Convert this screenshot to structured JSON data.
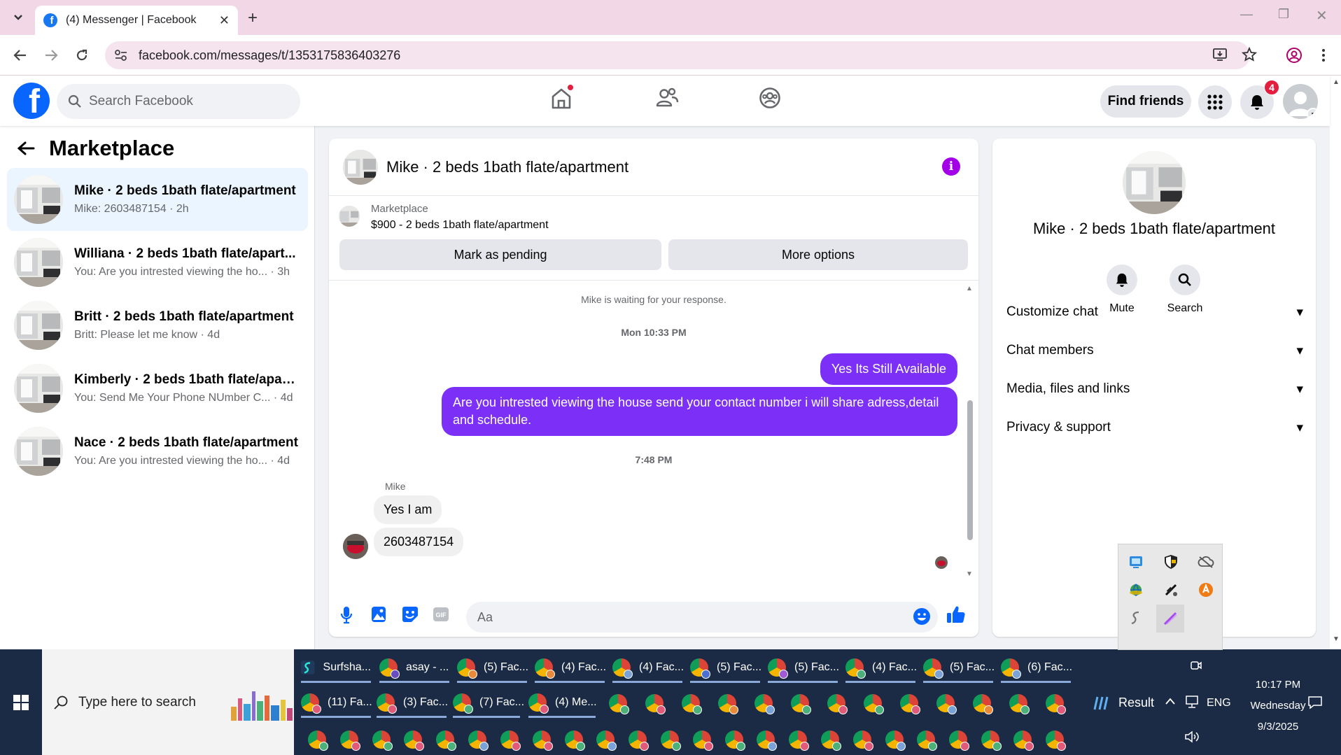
{
  "browser": {
    "tab_title": "(4) Messenger | Facebook",
    "url": "facebook.com/messages/t/1353175836403276"
  },
  "fb_header": {
    "search_placeholder": "Search Facebook",
    "find_friends": "Find friends",
    "notification_count": "4"
  },
  "left_panel": {
    "title": "Marketplace",
    "conversations": [
      {
        "name": "Mike · 2 beds 1bath flate/apartment",
        "preview": "Mike: 2603487154 · 2h",
        "active": true
      },
      {
        "name": "Williana · 2 beds 1bath flate/apart...",
        "preview": "You: Are you intrested viewing the ho... · 3h"
      },
      {
        "name": "Britt · 2 beds 1bath flate/apartment",
        "preview": "Britt: Please let me know · 4d"
      },
      {
        "name": "Kimberly · 2 beds 1bath flate/apart...",
        "preview": "You: Send Me Your Phone NUmber C... · 4d"
      },
      {
        "name": "Nace · 2 beds 1bath flate/apartment",
        "preview": "You: Are you intrested viewing the ho... · 4d"
      }
    ]
  },
  "chat": {
    "title": "Mike · 2 beds 1bath flate/apartment",
    "marketplace_label": "Marketplace",
    "listing": "$900 - 2 beds 1bath flate/apartment",
    "mark_pending": "Mark as pending",
    "more_options": "More options",
    "waiting": "Mike is waiting for your response.",
    "ts1": "Mon 10:33 PM",
    "out1": "Yes Its Still Available",
    "out2": "Are you intrested viewing the house send your contact number i will share adress,detail and schedule.",
    "ts2": "7:48 PM",
    "sender": "Mike",
    "in1": "Yes I am",
    "in2": "2603487154",
    "composer_placeholder": "Aa"
  },
  "right_panel": {
    "name": "Mike · 2 beds 1bath flate/apartment",
    "mute": "Mute",
    "search": "Search",
    "sections": [
      "Customize chat",
      "Chat members",
      "Media, files and links",
      "Privacy & support"
    ]
  },
  "taskbar": {
    "search_placeholder": "Type here to search",
    "row1": [
      "Surfsha...",
      "asay - ...",
      "(5) Fac...",
      "(4) Fac...",
      "(4) Fac...",
      "(5) Fac...",
      "(5) Fac...",
      "(4) Fac...",
      "(5) Fac...",
      "(6) Fac..."
    ],
    "row2": [
      "(11) Fa...",
      "(3) Fac...",
      "(7) Fac...",
      "(4) Me..."
    ],
    "weather": "Result",
    "lang": "ENG",
    "time": "10:17 PM",
    "day": "Wednesday",
    "date": "9/3/2025"
  },
  "colors": {
    "fb_blue": "#0866ff",
    "outgoing_bubble": "#7b2ff7",
    "badge_red": "#e41e3f",
    "taskbar": "#1b2b45"
  }
}
